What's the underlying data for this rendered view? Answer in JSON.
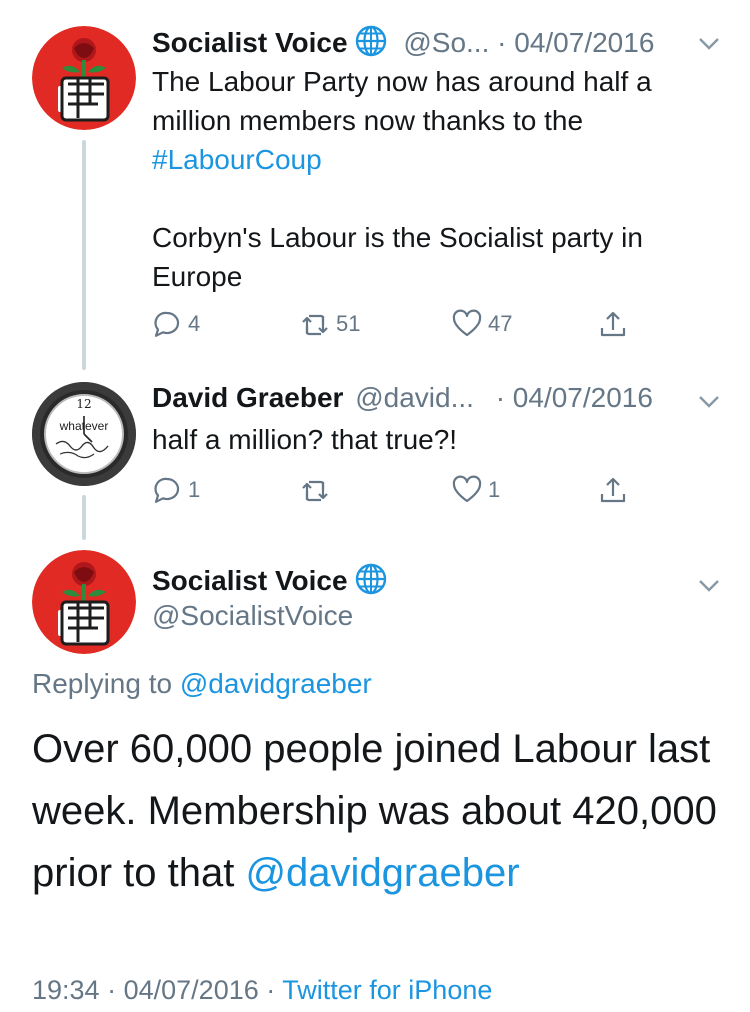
{
  "tweet1": {
    "display_name": "Socialist Voice",
    "handle": "@So...",
    "separator": "·",
    "date": "04/07/2016",
    "text_part1": "The Labour Party now has around half a million members now thanks to the",
    "hashtag": "#LabourCoup",
    "text_part2": "Corbyn's Labour is the Socialist party in Europe",
    "replies": "4",
    "retweets": "51",
    "likes": "47"
  },
  "tweet2": {
    "display_name": "David Graeber",
    "handle": "@david...",
    "separator": "·",
    "date": "04/07/2016",
    "text": "half a million? that true?!",
    "replies": "1",
    "retweets": "",
    "likes": "1",
    "avatar_clock_number": "12",
    "avatar_clock_text": "whatever"
  },
  "main_tweet": {
    "display_name": "Socialist Voice",
    "handle": "@SocialistVoice",
    "replying_to_label": "Replying to",
    "replying_to_handle": "@davidgraeber",
    "text": "Over 60,000 people joined Labour last week. Membership was about 420,000 prior to that",
    "mention": "@davidgraeber",
    "time": "19:34",
    "separator": "·",
    "date": "04/07/2016",
    "source_separator": "·",
    "source": "Twitter for iPhone"
  },
  "colors": {
    "link": "#1b95e0",
    "muted": "#657786",
    "thread_line": "#ccd6dd",
    "avatar_red": "#e02a23"
  }
}
